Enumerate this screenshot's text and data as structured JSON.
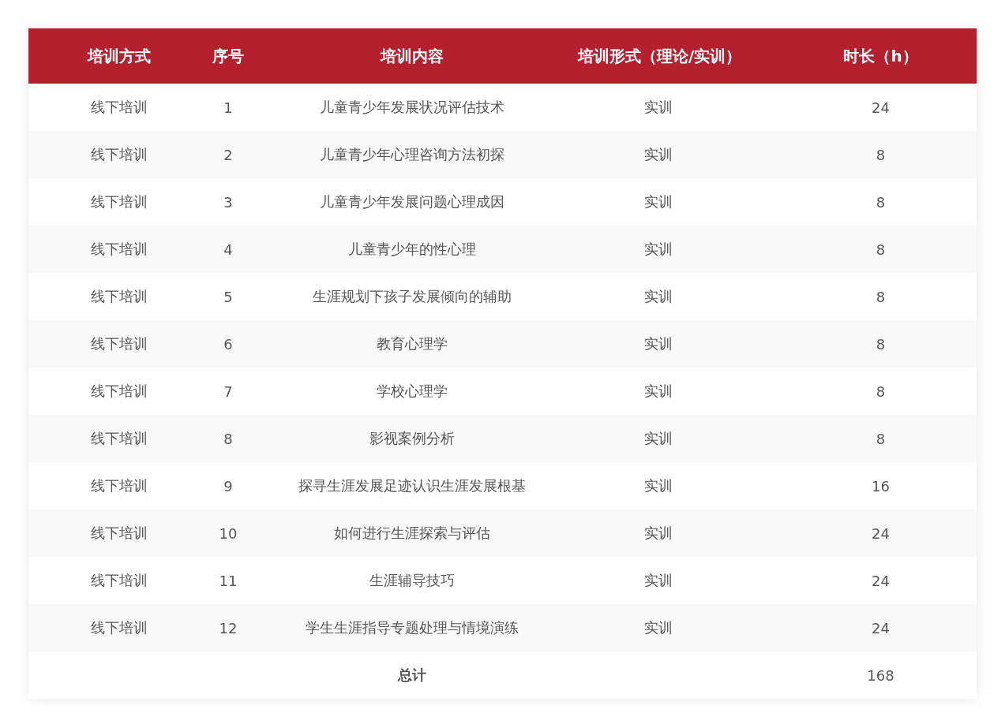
{
  "table": {
    "columns": [
      "培训方式",
      "序号",
      "培训内容",
      "培训形式（理论/实训）",
      "时长（h）"
    ],
    "rows": [
      {
        "cells": [
          "线下培训",
          "1",
          "儿童青少年发展状况评估技术",
          "实训",
          "24"
        ]
      },
      {
        "cells": [
          "线下培训",
          "2",
          "儿童青少年心理咨询方法初探",
          "实训",
          "8"
        ]
      },
      {
        "cells": [
          "线下培训",
          "3",
          "儿童青少年发展问题心理成因",
          "实训",
          "8"
        ]
      },
      {
        "cells": [
          "线下培训",
          "4",
          "儿童青少年的性心理",
          "实训",
          "8"
        ]
      },
      {
        "cells": [
          "线下培训",
          "5",
          "生涯规划下孩子发展倾向的辅助",
          "实训",
          "8"
        ]
      },
      {
        "cells": [
          "线下培训",
          "6",
          "教育心理学",
          "实训",
          "8"
        ]
      },
      {
        "cells": [
          "线下培训",
          "7",
          "学校心理学",
          "实训",
          "8"
        ]
      },
      {
        "cells": [
          "线下培训",
          "8",
          "影视案例分析",
          "实训",
          "8"
        ]
      },
      {
        "cells": [
          "线下培训",
          "9",
          "探寻生涯发展足迹认识生涯发展根基",
          "实训",
          "16"
        ]
      },
      {
        "cells": [
          "线下培训",
          "10",
          "如何进行生涯探索与评估",
          "实训",
          "24"
        ]
      },
      {
        "cells": [
          "线下培训",
          "11",
          "生涯辅导技巧",
          "实训",
          "24"
        ]
      },
      {
        "cells": [
          "线下培训",
          "12",
          "学生生涯指导专题处理与情境演练",
          "实训",
          "24"
        ]
      }
    ],
    "total": {
      "label": "总计",
      "value": "168"
    }
  }
}
